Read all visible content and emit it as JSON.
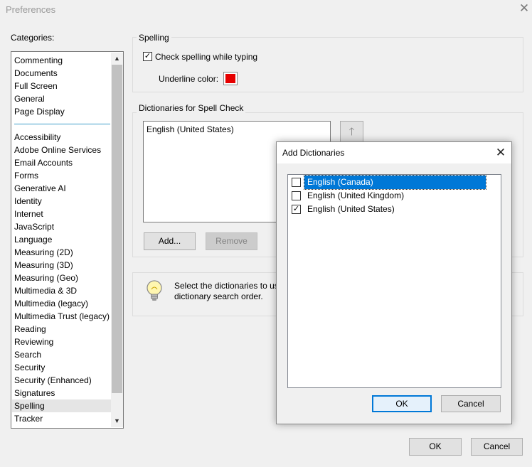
{
  "window": {
    "title": "Preferences",
    "close_glyph": "✕"
  },
  "categories": {
    "label": "Categories:",
    "top_items": [
      "Commenting",
      "Documents",
      "Full Screen",
      "General",
      "Page Display"
    ],
    "items": [
      "Accessibility",
      "Adobe Online Services",
      "Email Accounts",
      "Forms",
      "Generative AI",
      "Identity",
      "Internet",
      "JavaScript",
      "Language",
      "Measuring (2D)",
      "Measuring (3D)",
      "Measuring (Geo)",
      "Multimedia & 3D",
      "Multimedia (legacy)",
      "Multimedia Trust (legacy)",
      "Reading",
      "Reviewing",
      "Search",
      "Security",
      "Security (Enhanced)",
      "Signatures",
      "Spelling",
      "Tracker"
    ],
    "selected": "Spelling",
    "scroll_up_glyph": "▲",
    "scroll_down_glyph": "▼"
  },
  "spelling": {
    "legend": "Spelling",
    "check_label": "Check spelling while typing",
    "check_checked": true,
    "underline_label": "Underline color:",
    "underline_color": "#e60000"
  },
  "dictionaries": {
    "legend": "Dictionaries for Spell Check",
    "list": [
      "English (United States)"
    ],
    "move_up_glyph": "🡑",
    "add_label": "Add...",
    "remove_label": "Remove"
  },
  "info": {
    "text_line1": "Select the dictionaries to use",
    "text_line2": "dictionary search order.",
    "icon": "lightbulb-icon"
  },
  "footer": {
    "ok_label": "OK",
    "cancel_label": "Cancel"
  },
  "modal": {
    "title": "Add Dictionaries",
    "close_glyph": "✕",
    "items": [
      {
        "label": "English (Canada)",
        "checked": false,
        "selected": true
      },
      {
        "label": "English (United Kingdom)",
        "checked": false,
        "selected": false
      },
      {
        "label": "English (United States)",
        "checked": true,
        "selected": false
      }
    ],
    "ok_label": "OK",
    "cancel_label": "Cancel",
    "accent": "#0078d7"
  }
}
